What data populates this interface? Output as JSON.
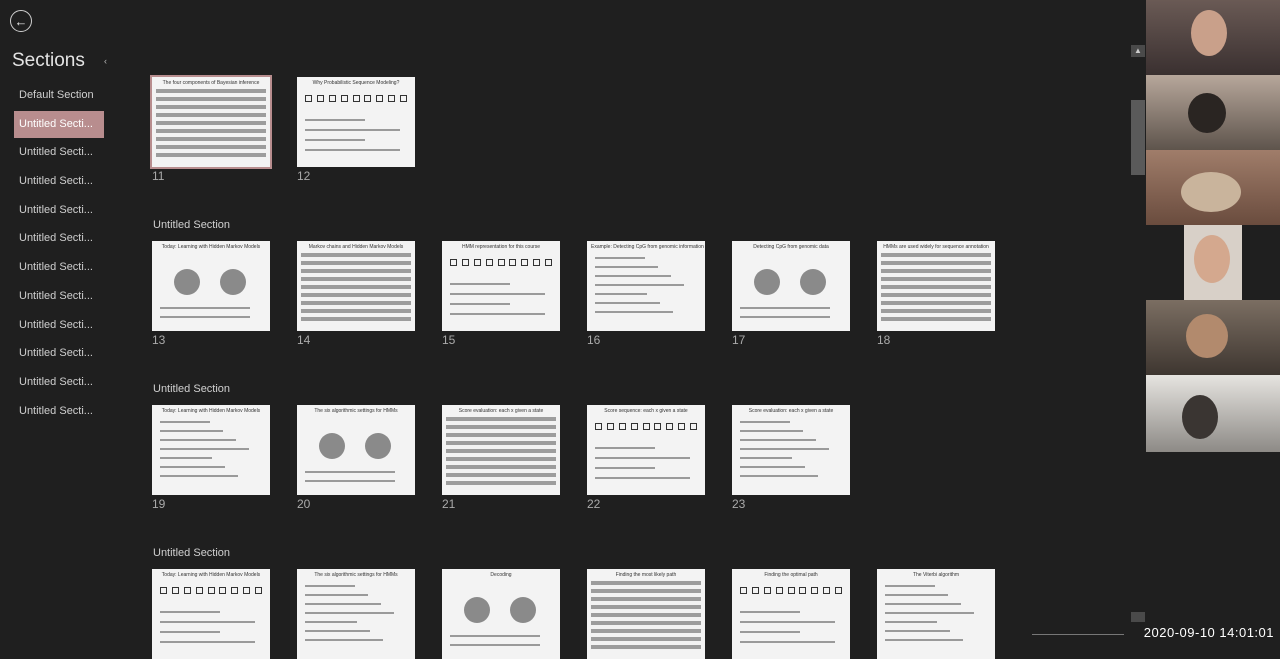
{
  "nav": {
    "back_icon": "←",
    "sections_title": "Sections",
    "collapse_icon": "‹"
  },
  "sections_list": [
    "Default Section",
    "Untitled Secti...",
    "Untitled Secti...",
    "Untitled Secti...",
    "Untitled Secti...",
    "Untitled Secti...",
    "Untitled Secti...",
    "Untitled Secti...",
    "Untitled Secti...",
    "Untitled Secti...",
    "Untitled Secti...",
    "Untitled Secti..."
  ],
  "groups": [
    {
      "header": "",
      "slides": [
        {
          "num": "11",
          "title": "The four components of Bayesian inference"
        },
        {
          "num": "12",
          "title": "Why Probabilistic Sequence Modeling?"
        }
      ]
    },
    {
      "header": "Untitled Section",
      "slides": [
        {
          "num": "13",
          "title": "Today: Learning with Hidden Markov Models"
        },
        {
          "num": "14",
          "title": "Markov chains and Hidden Markov Models"
        },
        {
          "num": "15",
          "title": "HMM representation for this course"
        },
        {
          "num": "16",
          "title": "Example: Detecting CpG from genomic information"
        },
        {
          "num": "17",
          "title": "Detecting CpG from genomic data"
        },
        {
          "num": "18",
          "title": "HMMs are used widely for sequence annotation"
        }
      ]
    },
    {
      "header": "Untitled Section",
      "slides": [
        {
          "num": "19",
          "title": "Today: Learning with Hidden Markov Models"
        },
        {
          "num": "20",
          "title": "The six algorithmic settings for HMMs"
        },
        {
          "num": "21",
          "title": "Score evaluation: each x given a state"
        },
        {
          "num": "22",
          "title": "Score sequence: each x given a state"
        },
        {
          "num": "23",
          "title": "Score evaluation: each x given a state"
        }
      ]
    },
    {
      "header": "Untitled Section",
      "slides": [
        {
          "num": "",
          "title": "Today: Learning with Hidden Markov Models"
        },
        {
          "num": "",
          "title": "The six algorithmic settings for HMMs"
        },
        {
          "num": "",
          "title": "Decoding"
        },
        {
          "num": "",
          "title": "Finding the most likely path"
        },
        {
          "num": "",
          "title": "Finding the optimal path"
        },
        {
          "num": "",
          "title": "The Viterbi algorithm"
        }
      ]
    }
  ],
  "video": {
    "participants": 6
  },
  "status": {
    "timestamp": "2020-09-10  14:01:01"
  },
  "colors": {
    "background": "#1f1f1f",
    "selection": "#b88d8e"
  }
}
